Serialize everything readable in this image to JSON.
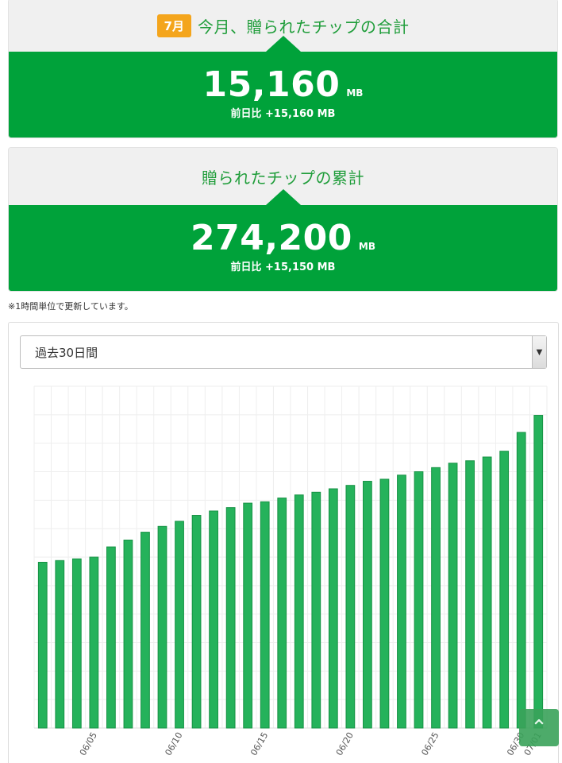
{
  "monthly": {
    "badge": "7月",
    "title": "今月、贈られたチップの合計",
    "value": "15,160",
    "unit": "MB",
    "diff": "前日比 +15,160 MB"
  },
  "cumulative": {
    "title": "贈られたチップの累計",
    "value": "274,200",
    "unit": "MB",
    "diff": "前日比 +15,150 MB"
  },
  "note": "※1時間単位で更新しています。",
  "period_select": {
    "selected": "過去30日間"
  },
  "scroll_top": {
    "icon": "chevron-up-icon"
  },
  "colors": {
    "green": "#00a23a",
    "bar": "#25b25b",
    "badge": "#f4a51c"
  },
  "chart_data": {
    "type": "bar",
    "title": "",
    "xlabel": "",
    "ylabel": "",
    "x_tick_labels": [
      "06/05",
      "06/10",
      "06/15",
      "06/20",
      "06/25",
      "06/30",
      "07/01"
    ],
    "tick_indices": [
      3,
      8,
      13,
      18,
      23,
      28,
      29
    ],
    "categories": [
      "06/02",
      "06/03",
      "06/04",
      "06/05",
      "06/06",
      "06/07",
      "06/08",
      "06/09",
      "06/10",
      "06/11",
      "06/12",
      "06/13",
      "06/14",
      "06/15",
      "06/16",
      "06/17",
      "06/18",
      "06/19",
      "06/20",
      "06/21",
      "06/22",
      "06/23",
      "06/24",
      "06/25",
      "06/26",
      "06/27",
      "06/28",
      "06/29",
      "06/30",
      "07/01"
    ],
    "values": [
      0.485,
      0.49,
      0.495,
      0.5,
      0.53,
      0.55,
      0.573,
      0.59,
      0.605,
      0.622,
      0.635,
      0.645,
      0.658,
      0.662,
      0.673,
      0.682,
      0.69,
      0.7,
      0.71,
      0.722,
      0.728,
      0.74,
      0.75,
      0.762,
      0.775,
      0.782,
      0.793,
      0.81,
      0.865,
      0.915
    ],
    "ylim": [
      0,
      1
    ],
    "grid": true
  }
}
